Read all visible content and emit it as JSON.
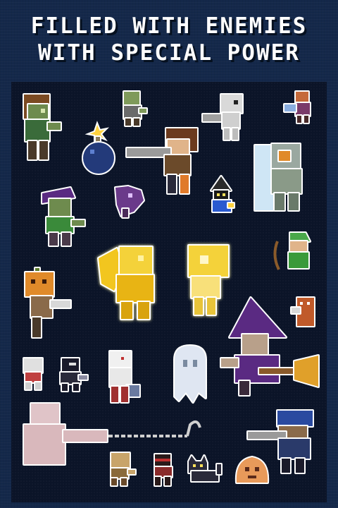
{
  "headline": {
    "line1": "FILLED WITH ENEMIES",
    "line2": "WITH SPECIAL POWER"
  },
  "colors": {
    "background": "#14284a",
    "panel": "#0b1428",
    "sprite_outline": "#ffffff",
    "gold": "#f2c61f",
    "witch_purple": "#5a2a82"
  },
  "sprites": [
    "zombie-brown-hair",
    "small-green-zombie",
    "skeleton-gunner",
    "axe-imp",
    "bomb",
    "gunman-brown-hair",
    "ice-knight",
    "purple-hat-zombie",
    "purple-imp",
    "black-mage",
    "golden-winged-statue",
    "golden-ghost-statue",
    "green-robin-archer",
    "pumpkin-head",
    "witch-on-broom",
    "small-tiki",
    "cracked-mini-skeleton",
    "black-ninja",
    "white-cat-axeman",
    "white-ghost",
    "pale-long-arm-grabber",
    "small-tan-creature",
    "small-red-ninja",
    "black-cat",
    "orange-blob",
    "blue-helmet-gunner"
  ]
}
